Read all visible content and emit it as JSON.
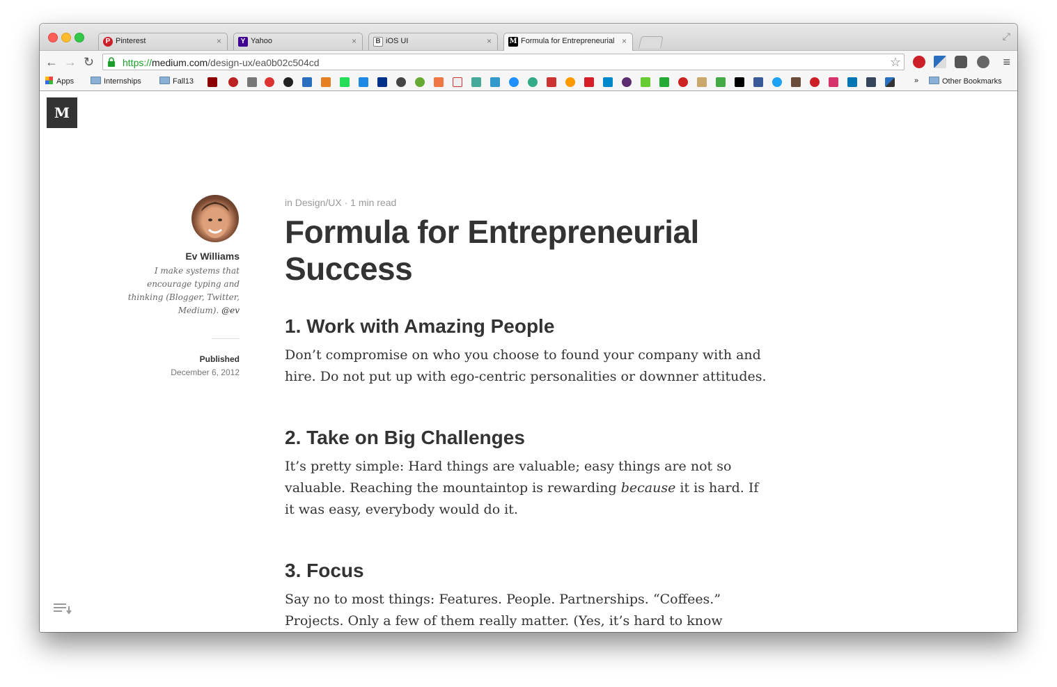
{
  "browser": {
    "tabs": [
      {
        "title": "Pinterest",
        "icon": "pinterest-icon",
        "color": "#cb2027"
      },
      {
        "title": "Yahoo",
        "icon": "yahoo-icon",
        "color": "#400191"
      },
      {
        "title": "iOS UI",
        "icon": "bootstrap-icon",
        "color": "#ffffff"
      },
      {
        "title": "Formula for Entrepreneurial",
        "icon": "medium-icon",
        "color": "#000000"
      }
    ],
    "close_glyph": "×",
    "url_scheme": "https://",
    "url_host": "medium.com",
    "url_path": "/design-ux/ea0b02c504cd",
    "bookmarks": {
      "apps": "Apps",
      "internships": "Internships",
      "fall13": "Fall13",
      "overflow": "»",
      "other": "Other Bookmarks"
    }
  },
  "article": {
    "logo": "M",
    "author": {
      "name": "Ev Williams",
      "bio_line1": "I make systems that",
      "bio_line2": "encourage typing and",
      "bio_line3": "thinking (Blogger, Twitter,",
      "bio_line4": "Medium).",
      "handle": "@ev"
    },
    "published_label": "Published",
    "published_date": "December 6, 2012",
    "meta": "in Design/UX · 1 min read",
    "title_line1": "Formula for Entrepreneurial",
    "title_line2": "Success",
    "sections": [
      {
        "heading": "1. Work with Amazing People",
        "line1": "Don’t compromise on who you choose to found your company with and",
        "line2": "hire. Do not put up with ego-centric personalities or downner attitudes."
      },
      {
        "heading": "2. Take on Big Challenges",
        "line1": "It’s pretty simple: Hard things are valuable; easy things are not so",
        "line2a": "valuable. Reaching the mountaintop is rewarding ",
        "line2em": "because",
        "line2b": " it is hard. If",
        "line3": "it was easy, everybody would do it."
      },
      {
        "heading": "3. Focus",
        "line1": "Say no to most things: Features. People. Partnerships. “Coffees.”",
        "line2": "Projects. Only a few of them really matter. (Yes, it’s hard to know"
      }
    ]
  }
}
